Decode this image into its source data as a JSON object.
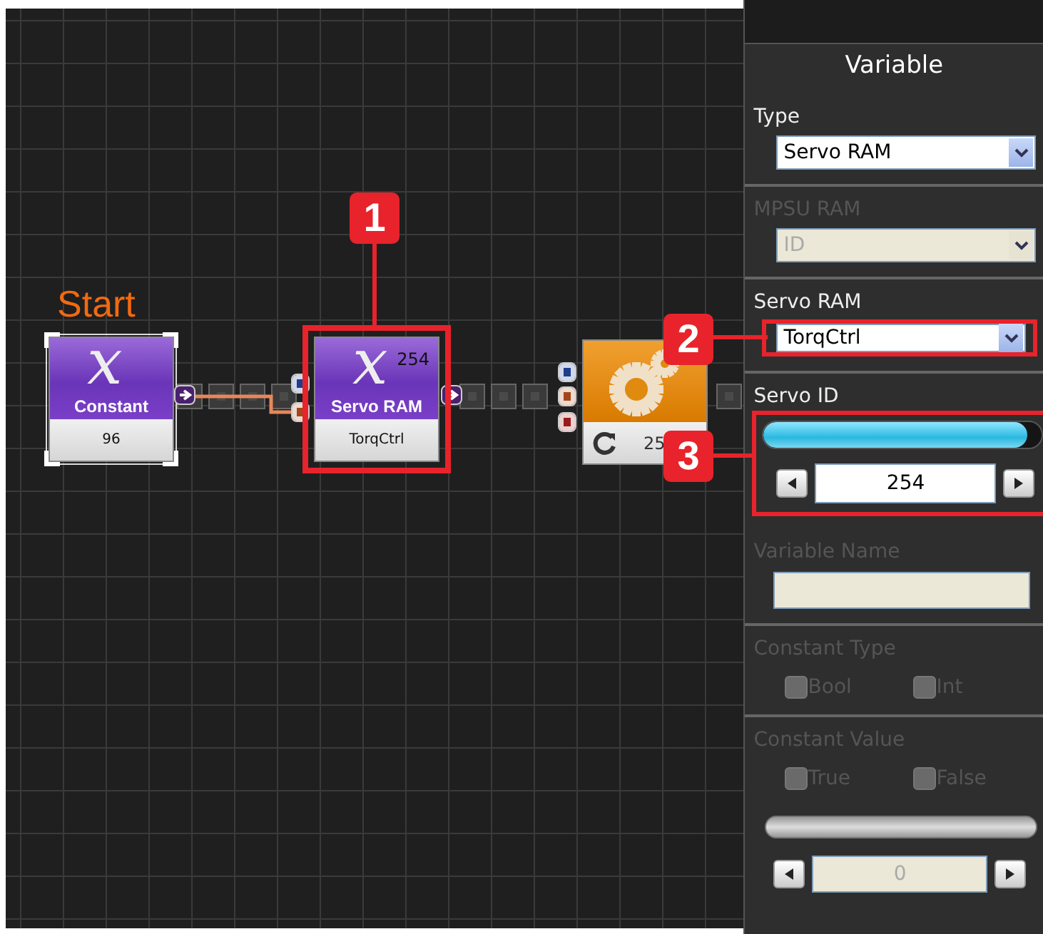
{
  "canvas": {
    "start_label": "Start",
    "nodes": [
      {
        "kind": "variable",
        "symbol": "x",
        "title": "Constant",
        "value": "96",
        "selected": true
      },
      {
        "kind": "variable",
        "symbol": "x",
        "title": "Servo RAM",
        "number": "254",
        "value": "TorqCtrl",
        "selected": false
      },
      {
        "kind": "gear",
        "value": "25",
        "selected": false
      }
    ]
  },
  "callouts": [
    {
      "number": "1"
    },
    {
      "number": "2"
    },
    {
      "number": "3"
    }
  ],
  "panel": {
    "title": "Variable",
    "type": {
      "label": "Type",
      "value": "Servo RAM",
      "disabled": false
    },
    "mpsu_ram": {
      "label": "MPSU RAM",
      "value": "ID",
      "disabled": true
    },
    "servo_ram": {
      "label": "Servo RAM",
      "value": "TorqCtrl",
      "disabled": false
    },
    "servo_id": {
      "label": "Servo ID",
      "level": 0.95,
      "value": "254",
      "disabled": false
    },
    "variable_name": {
      "label": "Variable Name",
      "disabled": true
    },
    "constant_type": {
      "label": "Constant Type",
      "disabled": true,
      "options": [
        {
          "label": "Bool",
          "checked": false
        },
        {
          "label": "Int",
          "checked": false
        }
      ]
    },
    "constant_value": {
      "label": "Constant Value",
      "disabled": true,
      "options": [
        {
          "label": "True",
          "checked": false
        },
        {
          "label": "False",
          "checked": false
        }
      ],
      "value": "0"
    }
  }
}
